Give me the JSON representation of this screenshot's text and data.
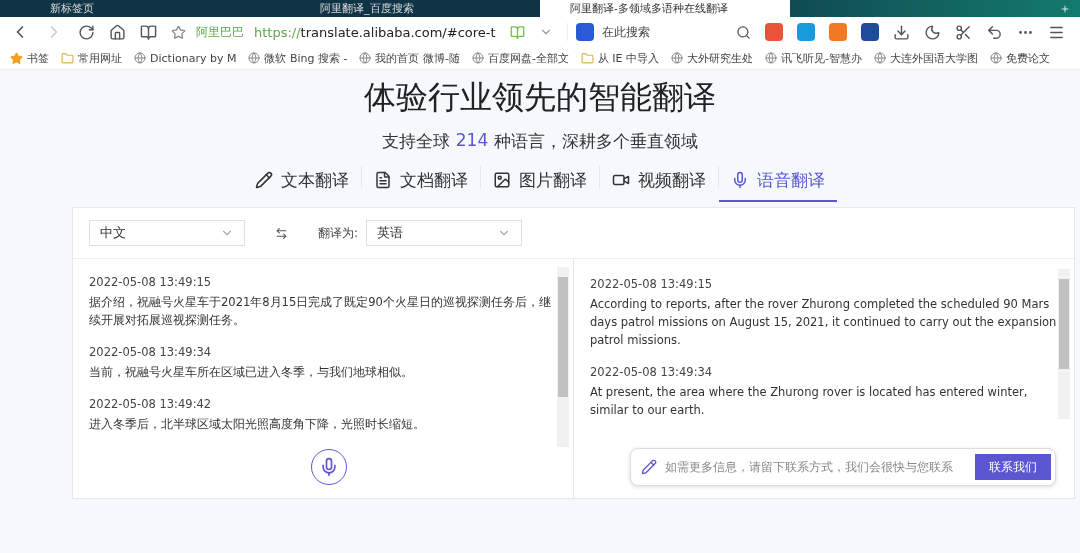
{
  "browser": {
    "tabs": [
      {
        "title": "新标签页",
        "selected": false
      },
      {
        "title": "阿里翻译_百度搜索",
        "selected": false
      },
      {
        "title": "阿里翻译-多领域多语种在线翻译",
        "selected": true
      }
    ],
    "site_label": "阿里巴巴",
    "url_scheme": "https://",
    "url_rest": "translate.alibaba.com/#core-t",
    "search_placeholder": "在此搜索",
    "bookmarks": [
      {
        "label": "书签",
        "kind": "star"
      },
      {
        "label": "常用网址",
        "kind": "folder"
      },
      {
        "label": "Dictionary by M",
        "kind": "site"
      },
      {
        "label": "微软 Bing 搜索 -",
        "kind": "site"
      },
      {
        "label": "我的首页 微博-随",
        "kind": "site"
      },
      {
        "label": "百度网盘-全部文",
        "kind": "site"
      },
      {
        "label": "从 IE 中导入",
        "kind": "folder"
      },
      {
        "label": "大外研究生处",
        "kind": "site"
      },
      {
        "label": "讯飞听见-智慧办",
        "kind": "site"
      },
      {
        "label": "大连外国语大学图",
        "kind": "site"
      },
      {
        "label": "免费论文",
        "kind": "site"
      }
    ]
  },
  "page": {
    "title": "体验行业领先的智能翻译",
    "subtitle_before": "支持全球",
    "language_count": "214",
    "subtitle_after": "种语言，深耕多个垂直领域",
    "modes": [
      {
        "label": "文本翻译",
        "kind": "text",
        "selected": false
      },
      {
        "label": "文档翻译",
        "kind": "document",
        "selected": false
      },
      {
        "label": "图片翻译",
        "kind": "image",
        "selected": false
      },
      {
        "label": "视频翻译",
        "kind": "video",
        "selected": false
      },
      {
        "label": "语音翻译",
        "kind": "voice",
        "selected": true
      }
    ],
    "source_language": "中文",
    "target_label": "翻译为:",
    "target_language": "英语",
    "source_entries": [
      {
        "time": "2022-05-08 13:49:15",
        "text": "据介绍，祝融号火星车于2021年8月15日完成了既定90个火星日的巡视探测任务后，继续开展对拓展巡视探测任务。"
      },
      {
        "time": "2022-05-08 13:49:34",
        "text": "当前，祝融号火星车所在区域已进入冬季，与我们地球相似。"
      },
      {
        "time": "2022-05-08 13:49:42",
        "text": "进入冬季后，北半球区域太阳光照高度角下降，光照时长缩短。"
      }
    ],
    "target_entries": [
      {
        "time": "2022-05-08 13:49:15",
        "text": "According to reports, after the rover Zhurong completed the scheduled 90 Mars days patrol missions on August 15, 2021, it continued to carry out the expansion patrol missions."
      },
      {
        "time": "2022-05-08 13:49:34",
        "text": "At present, the area where the Zhurong rover is located has entered winter, similar to our earth."
      }
    ],
    "contact_placeholder": "如需更多信息，请留下联系方式，我们会很快与您联系",
    "contact_button": "联系我们"
  }
}
